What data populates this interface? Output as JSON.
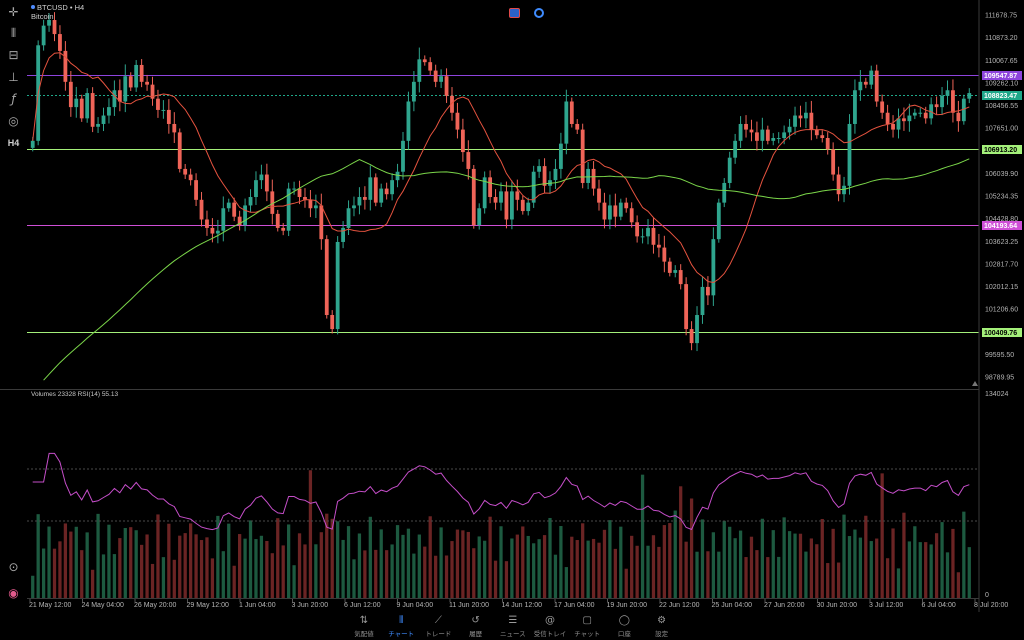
{
  "chart": {
    "symbol": "BTCUSD",
    "timeframe": "H4",
    "description": "Bitcoin",
    "indicator_label": "Volumes 23328 RSI(14) 55.13"
  },
  "toolbar": {
    "timeframe_badge": "H4"
  },
  "price_axis": {
    "ticks": [
      "111678.75",
      "110873.20",
      "110067.65",
      "109262.10",
      "108456.55",
      "107651.00",
      "106039.90",
      "105234.35",
      "104428.80",
      "103623.25",
      "102817.70",
      "102012.15",
      "101206.60",
      "99595.50",
      "98789.95"
    ],
    "tick_values": [
      111678.75,
      110873.2,
      110067.65,
      109262.1,
      108456.55,
      107651.0,
      106039.9,
      105234.35,
      104428.8,
      103623.25,
      102817.7,
      102012.15,
      101206.6,
      99595.5,
      98789.95
    ],
    "range": [
      98402,
      111999
    ]
  },
  "volume_axis": {
    "top_label": "134024",
    "bottom_label": "0"
  },
  "levels": [
    {
      "label": "109547.87",
      "value": 109547.87,
      "color": "#8e44dd",
      "text_color": "#ffffff"
    },
    {
      "label": "108823.47",
      "value": 108823.47,
      "color": "#1fa88a",
      "text_color": "#ffffff"
    },
    {
      "label": "106913.20",
      "value": 106913.2,
      "color": "#a4f07a",
      "text_color": "#000000"
    },
    {
      "label": "104193.64",
      "value": 104193.64,
      "color": "#cf4fd6",
      "text_color": "#ffffff"
    },
    {
      "label": "100409.76",
      "value": 100409.76,
      "color": "#a4f07a",
      "text_color": "#000000"
    }
  ],
  "time_axis": {
    "labels": [
      "21 May 12:00",
      "24 May 04:00",
      "26 May 20:00",
      "29 May 12:00",
      "1 Jun 04:00",
      "3 Jun 20:00",
      "6 Jun 12:00",
      "9 Jun 04:00",
      "11 Jun 20:00",
      "14 Jun 12:00",
      "17 Jun 04:00",
      "19 Jun 20:00",
      "22 Jun 12:00",
      "25 Jun 04:00",
      "27 Jun 20:00",
      "30 Jun 20:00",
      "3 Jul 12:00",
      "6 Jul 04:00",
      "8 Jul 20:00"
    ]
  },
  "nav": [
    {
      "label": "気配値",
      "icon": "quotes-icon",
      "glyph": "⇅",
      "active": false
    },
    {
      "label": "チャート",
      "icon": "chart-icon",
      "glyph": "⫴",
      "active": true
    },
    {
      "label": "トレード",
      "icon": "trade-icon",
      "glyph": "⟋",
      "active": false
    },
    {
      "label": "履歴",
      "icon": "history-icon",
      "glyph": "↺",
      "active": false
    },
    {
      "label": "ニュース",
      "icon": "news-icon",
      "glyph": "☰",
      "active": false
    },
    {
      "label": "受信トレイ",
      "icon": "inbox-icon",
      "glyph": "@",
      "active": false
    },
    {
      "label": "チャット",
      "icon": "chat-icon",
      "glyph": "▢",
      "active": false
    },
    {
      "label": "口座",
      "icon": "account-icon",
      "glyph": "◯",
      "active": false
    },
    {
      "label": "設定",
      "icon": "settings-icon",
      "glyph": "⚙",
      "active": false
    }
  ],
  "colors": {
    "bull": "#2fa58e",
    "bear": "#ef6458",
    "ma_fast": "#e5533f",
    "ma_slow": "#7bd64a",
    "rsi": "#c54ec9",
    "accent": "#3f8cff"
  },
  "chart_data": {
    "type": "candlestick",
    "ma_fast": "moving average (red)",
    "ma_slow": "moving average (green)",
    "closes": [
      107200,
      110600,
      111300,
      111500,
      111000,
      110400,
      109300,
      108400,
      108700,
      108000,
      108900,
      107700,
      107800,
      108100,
      108400,
      109000,
      108600,
      109500,
      109100,
      109900,
      109300,
      109200,
      108700,
      108300,
      108300,
      107800,
      107500,
      106200,
      106000,
      105800,
      105100,
      104400,
      104100,
      103900,
      104000,
      104800,
      105000,
      104500,
      104200,
      104900,
      105200,
      105800,
      106000,
      105400,
      104600,
      104100,
      104000,
      105500,
      105500,
      105200,
      105100,
      104800,
      104900,
      103700,
      101000,
      100500,
      103600,
      104100,
      104800,
      104900,
      105200,
      105100,
      105900,
      105000,
      105500,
      105300,
      105800,
      106100,
      107200,
      108600,
      109300,
      110100,
      110000,
      109700,
      109300,
      109500,
      108800,
      108200,
      107600,
      106800,
      106200,
      104200,
      104800,
      105900,
      105200,
      105000,
      105400,
      104400,
      105400,
      105100,
      104700,
      105000,
      106100,
      106300,
      105600,
      105800,
      106200,
      107100,
      108600,
      107800,
      107600,
      105700,
      106200,
      105500,
      105000,
      104400,
      104900,
      104500,
      105000,
      104800,
      104300,
      103800,
      103800,
      104100,
      103500,
      103400,
      102900,
      102500,
      102600,
      102100,
      100500,
      100000,
      101000,
      102000,
      101700,
      103700,
      105000,
      105700,
      106600,
      107200,
      107800,
      107600,
      107500,
      107200,
      107600,
      107200,
      107300,
      107300,
      107500,
      107700,
      108100,
      108000,
      108200,
      107600,
      107400,
      107300,
      106900,
      106000,
      105300,
      105600,
      107800,
      109000,
      109300,
      109200,
      109700,
      108600,
      108200,
      107800,
      107600,
      108000,
      107900,
      108100,
      108200,
      108200,
      108000,
      108500,
      108400,
      108800,
      109000,
      108200,
      107900,
      108700,
      108900
    ]
  }
}
